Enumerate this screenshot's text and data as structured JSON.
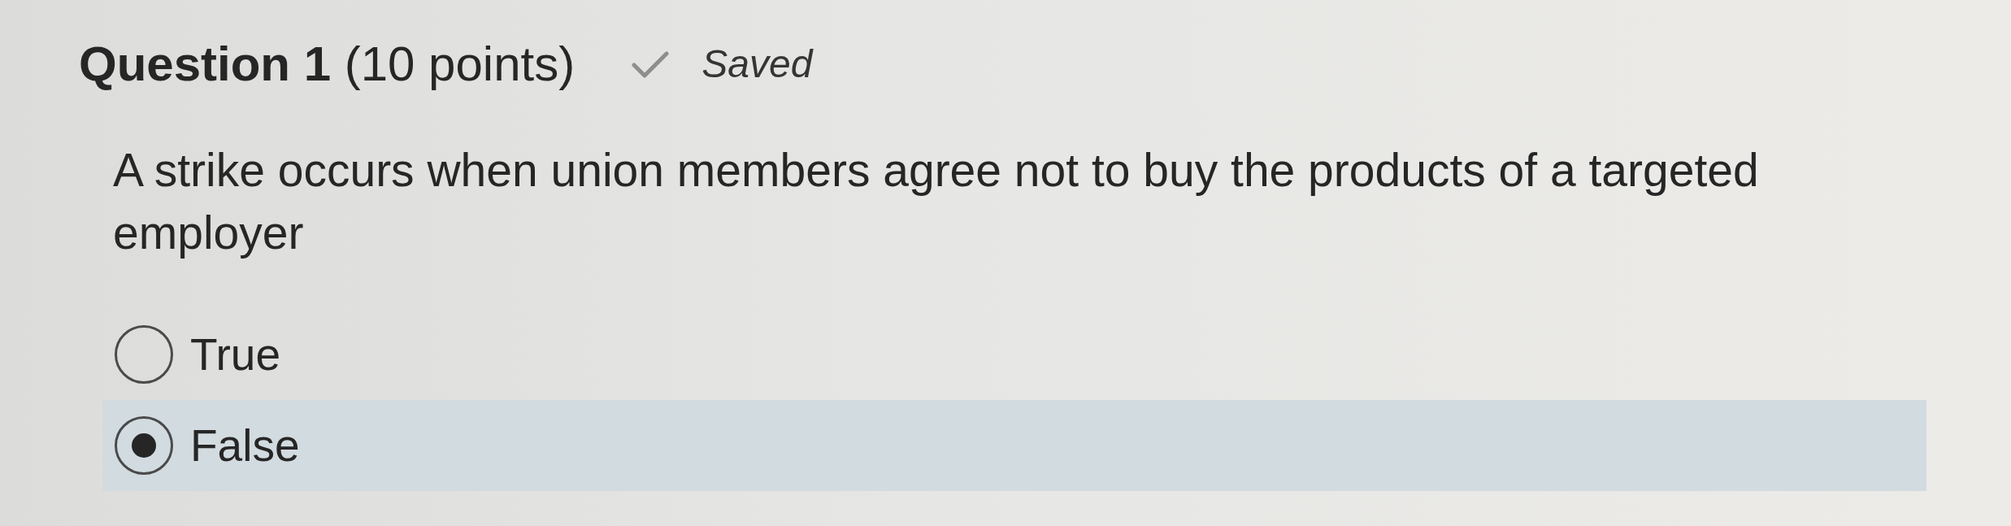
{
  "question": {
    "heading": "**Question 1** (10 points)",
    "save_status": "Saved",
    "prompt": "A strike occurs when union members agree not to buy the products of a targeted employer"
  },
  "options": [
    {
      "label": "True",
      "selected": false
    },
    {
      "label": "False",
      "selected": true
    }
  ]
}
